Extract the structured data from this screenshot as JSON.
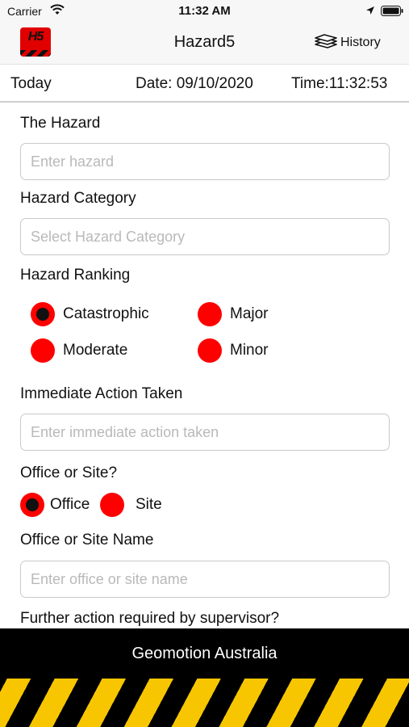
{
  "status_bar": {
    "carrier": "Carrier",
    "time": "11:32 AM"
  },
  "nav": {
    "logo_text": "H5",
    "title": "Hazard5",
    "history_label": "History"
  },
  "date_row": {
    "today": "Today",
    "date": "Date: 09/10/2020",
    "time": "Time:11:32:53"
  },
  "form": {
    "hazard": {
      "label": "The Hazard",
      "placeholder": "Enter hazard",
      "value": ""
    },
    "category": {
      "label": "Hazard Category",
      "placeholder": "Select Hazard Category",
      "value": ""
    },
    "ranking": {
      "label": "Hazard Ranking",
      "options": [
        "Catastrophic",
        "Major",
        "Moderate",
        "Minor"
      ],
      "selected": "Catastrophic"
    },
    "immediate_action": {
      "label": "Immediate Action Taken",
      "placeholder": "Enter immediate action taken",
      "value": ""
    },
    "office_or_site": {
      "label": "Office or Site?",
      "options": [
        "Office",
        "Site"
      ],
      "selected": "Office"
    },
    "site_name": {
      "label": "Office or Site Name",
      "placeholder": "Enter office or site name",
      "value": ""
    },
    "further_action": {
      "label": "Further action required by supervisor?"
    }
  },
  "footer": {
    "brand": "Geomotion Australia"
  },
  "colors": {
    "radio_red": "#ff0000",
    "logo_red": "#e10000",
    "stripe_yellow": "#f7c600",
    "footer_black": "#000000"
  },
  "icons": [
    "wifi-icon",
    "location-icon",
    "battery-icon",
    "history-icon"
  ]
}
